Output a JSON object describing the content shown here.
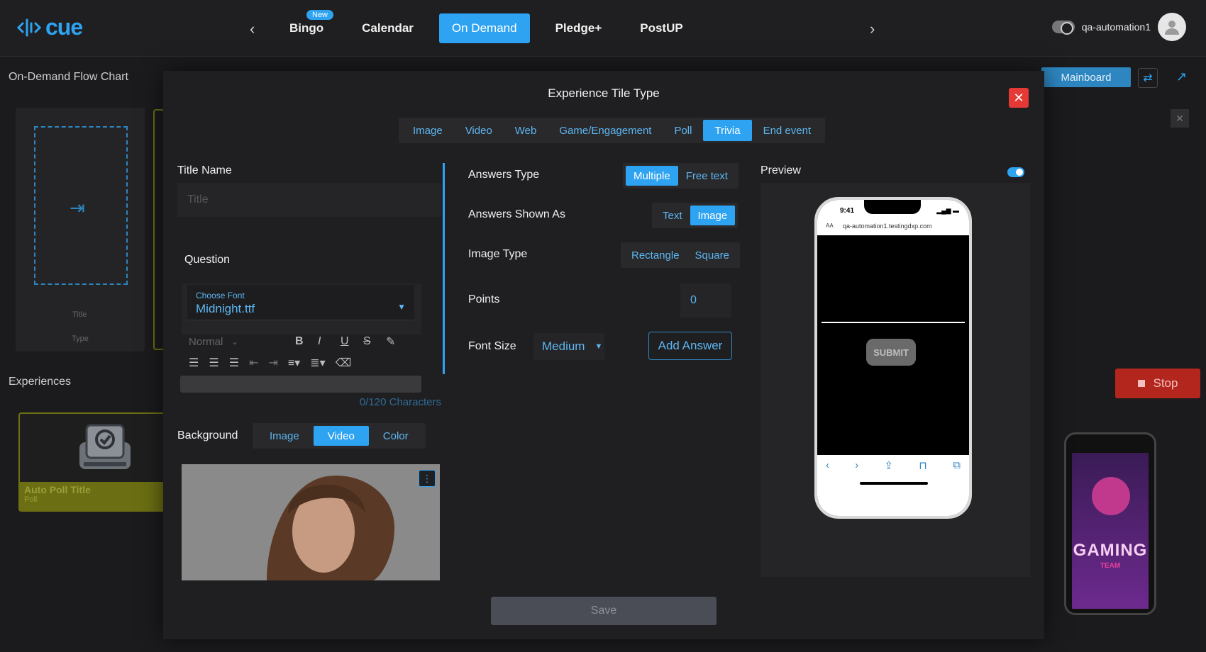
{
  "app": {
    "logo_text": "cue",
    "user_name": "qa-automation1"
  },
  "topnav": {
    "items": [
      {
        "label": "Bingo",
        "badge": "New"
      },
      {
        "label": "Calendar"
      },
      {
        "label": "On Demand",
        "active": true
      },
      {
        "label": "Pledge+"
      },
      {
        "label": "PostUP"
      }
    ]
  },
  "background": {
    "flow_chart_title": "On-Demand Flow Chart",
    "experiences_title": "Experiences",
    "card_title_label": "Title",
    "card_type_label": "Type",
    "mainboard_label": "Mainboard",
    "stop_label": "Stop",
    "poll_card": {
      "title": "Auto Poll Title",
      "type": "Poll"
    },
    "mini_phone_text": "GAMING",
    "mini_phone_sub": "TEAM"
  },
  "modal": {
    "title": "Experience Tile Type",
    "tabs": [
      "Image",
      "Video",
      "Web",
      "Game/Engagement",
      "Poll",
      "Trivia",
      "End event"
    ],
    "active_tab": "Trivia",
    "title_name_label": "Title Name",
    "title_placeholder": "Title",
    "question_label": "Question",
    "choose_font_label": "Choose Font",
    "font_value": "Midnight.ttf",
    "editor_normal": "Normal",
    "char_count": "0/120 Characters",
    "background_label": "Background",
    "background_options": [
      "Image",
      "Video",
      "Color"
    ],
    "background_active": "Video",
    "answers_type_label": "Answers Type",
    "answers_type_options": [
      "Multiple",
      "Free text"
    ],
    "answers_type_active": "Multiple",
    "answers_shown_label": "Answers Shown As",
    "answers_shown_options": [
      "Text",
      "Image"
    ],
    "answers_shown_active": "Image",
    "image_type_label": "Image Type",
    "image_type_options": [
      "Rectangle",
      "Square"
    ],
    "points_label": "Points",
    "points_value": "0",
    "font_size_label": "Font Size",
    "font_size_value": "Medium",
    "add_answer_label": "Add Answer",
    "preview_label": "Preview",
    "phone": {
      "time": "9:41",
      "url": "qa-automation1.testingdxp.com",
      "aa": "AA",
      "submit": "SUBMIT"
    },
    "save_label": "Save"
  },
  "colors": {
    "accent": "#2ea3f2",
    "danger": "#e53935",
    "poll_green": "#6b6e12"
  }
}
